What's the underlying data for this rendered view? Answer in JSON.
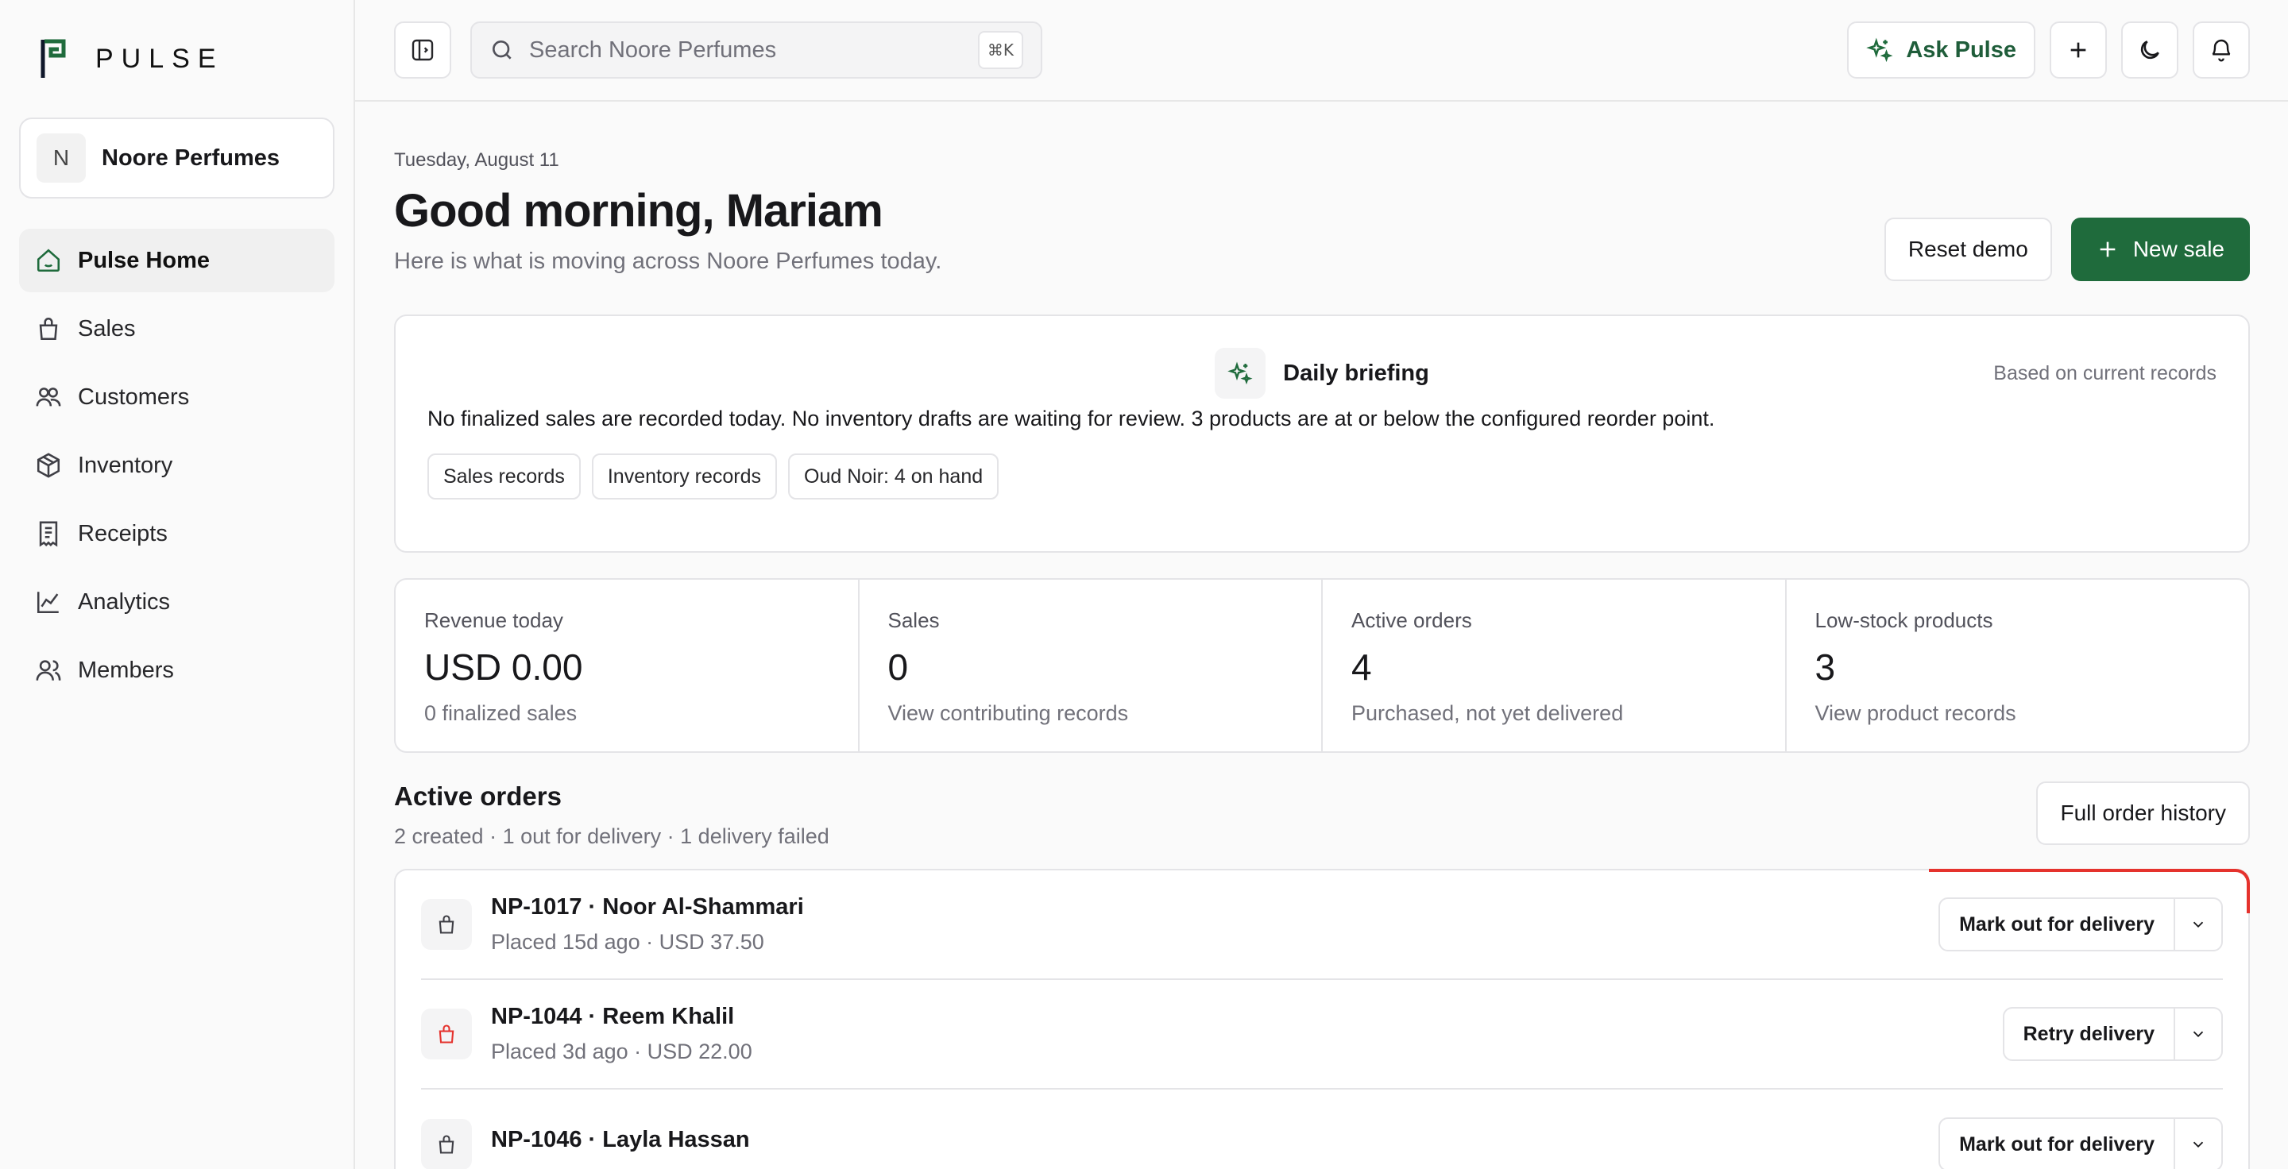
{
  "app": {
    "name": "PULSE"
  },
  "org": {
    "initial": "N",
    "name": "Noore Perfumes"
  },
  "nav": [
    {
      "label": "Pulse Home",
      "icon": "home-icon",
      "active": true
    },
    {
      "label": "Sales",
      "icon": "shopping-bag-icon"
    },
    {
      "label": "Customers",
      "icon": "users-icon"
    },
    {
      "label": "Inventory",
      "icon": "package-icon"
    },
    {
      "label": "Receipts",
      "icon": "receipt-icon"
    },
    {
      "label": "Analytics",
      "icon": "chart-line-icon"
    },
    {
      "label": "Members",
      "icon": "members-icon"
    }
  ],
  "topbar": {
    "search_placeholder": "Search Noore Perfumes",
    "shortcut": "⌘K",
    "ask_label": "Ask Pulse"
  },
  "header": {
    "date": "Tuesday, August 11",
    "greeting": "Good morning, Mariam",
    "subline": "Here is what is moving across Noore Perfumes today.",
    "reset_label": "Reset demo",
    "new_sale_label": "New sale"
  },
  "briefing": {
    "title": "Daily briefing",
    "note": "Based on current records",
    "text": "No finalized sales are recorded today. No inventory drafts are waiting for review. 3 products are at or below the configured reorder point.",
    "chips": [
      "Sales records",
      "Inventory records",
      "Oud Noir: 4 on hand"
    ]
  },
  "stats": [
    {
      "label": "Revenue today",
      "value": "USD 0.00",
      "sub": "0 finalized sales"
    },
    {
      "label": "Sales",
      "value": "0",
      "sub": "View contributing records"
    },
    {
      "label": "Active orders",
      "value": "4",
      "sub": "Purchased, not yet delivered"
    },
    {
      "label": "Low-stock products",
      "value": "3",
      "sub": "View product records"
    }
  ],
  "orders": {
    "title": "Active orders",
    "summary": "2 created · 1 out for delivery · 1 delivery failed",
    "history_label": "Full order history",
    "rows": [
      {
        "title": "NP-1017 · Noor Al-Shammari",
        "meta": "Placed 15d ago · USD 37.50",
        "action": "Mark out for delivery",
        "status": "created"
      },
      {
        "title": "NP-1044 · Reem Khalil",
        "meta": "Placed 3d ago · USD 22.00",
        "action": "Retry delivery",
        "status": "failed"
      },
      {
        "title": "NP-1046 · Layla Hassan",
        "meta": "",
        "action": "Mark out for delivery",
        "status": "created"
      }
    ]
  },
  "colors": {
    "brand": "#1f6b3c",
    "error": "#e5322d"
  }
}
